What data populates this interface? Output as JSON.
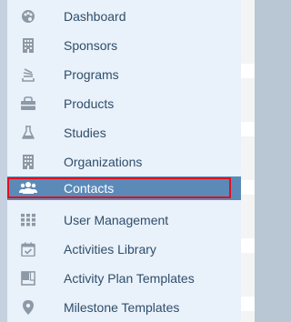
{
  "colors": {
    "sidebar_bg": "#e9f1fa",
    "text": "#2f4e6b",
    "icon": "#8d99a6",
    "active_bg": "#5b8ab8",
    "active_text": "#ffffff",
    "highlight_border": "#e0101e"
  },
  "sidebar": {
    "items": [
      {
        "label": "Dashboard",
        "icon": "palette-icon",
        "active": false
      },
      {
        "label": "Sponsors",
        "icon": "building-icon",
        "active": false
      },
      {
        "label": "Programs",
        "icon": "stack-icon",
        "active": false
      },
      {
        "label": "Products",
        "icon": "shopping-bag-icon",
        "active": false
      },
      {
        "label": "Studies",
        "icon": "flask-icon",
        "active": false
      },
      {
        "label": "Organizations",
        "icon": "building-icon",
        "active": false
      },
      {
        "label": "Contacts",
        "icon": "users-icon",
        "active": true
      },
      {
        "label": "User Management",
        "icon": "grid-icon",
        "active": false
      },
      {
        "label": "Activities Library",
        "icon": "calendar-check-icon",
        "active": false
      },
      {
        "label": "Activity Plan Templates",
        "icon": "template-icon",
        "active": false
      },
      {
        "label": "Milestone Templates",
        "icon": "map-pin-icon",
        "active": false
      }
    ]
  }
}
